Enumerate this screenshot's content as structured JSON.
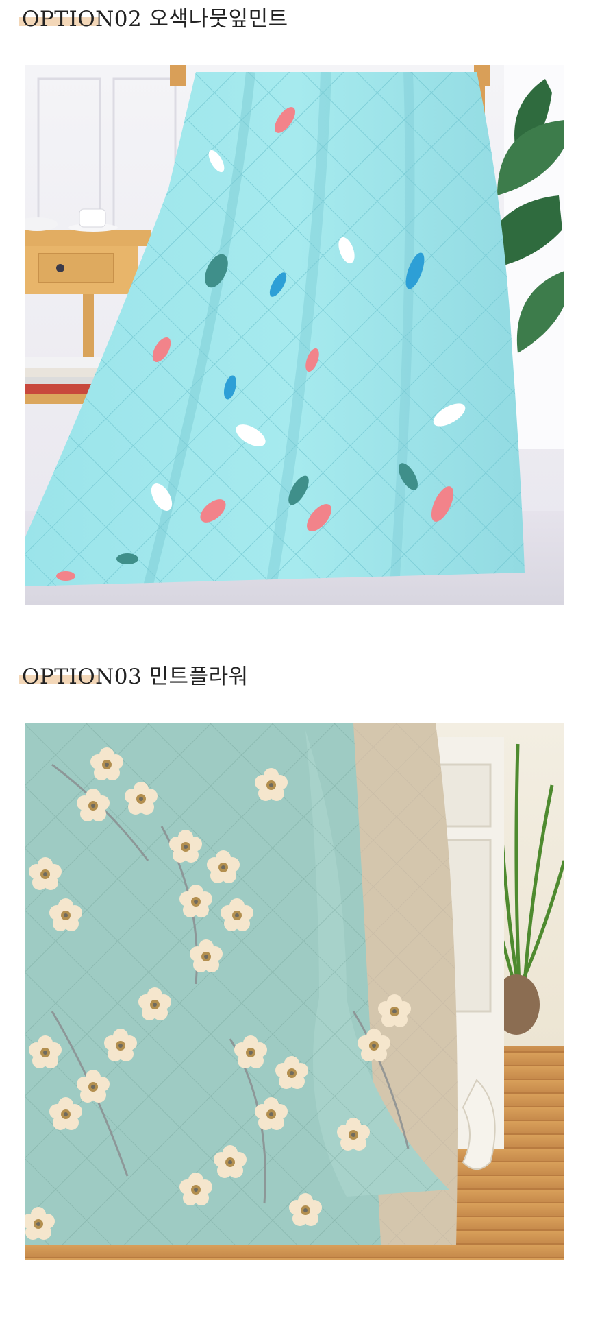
{
  "options": [
    {
      "title": "OPTION02  오색나뭇잎민트",
      "image": "mint-quilt-with-colorful-leaves-photo"
    },
    {
      "title": "OPTION03  민트플라워",
      "image": "mint-quilt-with-flowers-photo"
    }
  ],
  "colors": {
    "heading_underline": "#f3d7b8",
    "mint_quilt": "#8fdde4",
    "mint_flower_quilt": "#9ecbc3",
    "wood": "#e2ad62"
  }
}
